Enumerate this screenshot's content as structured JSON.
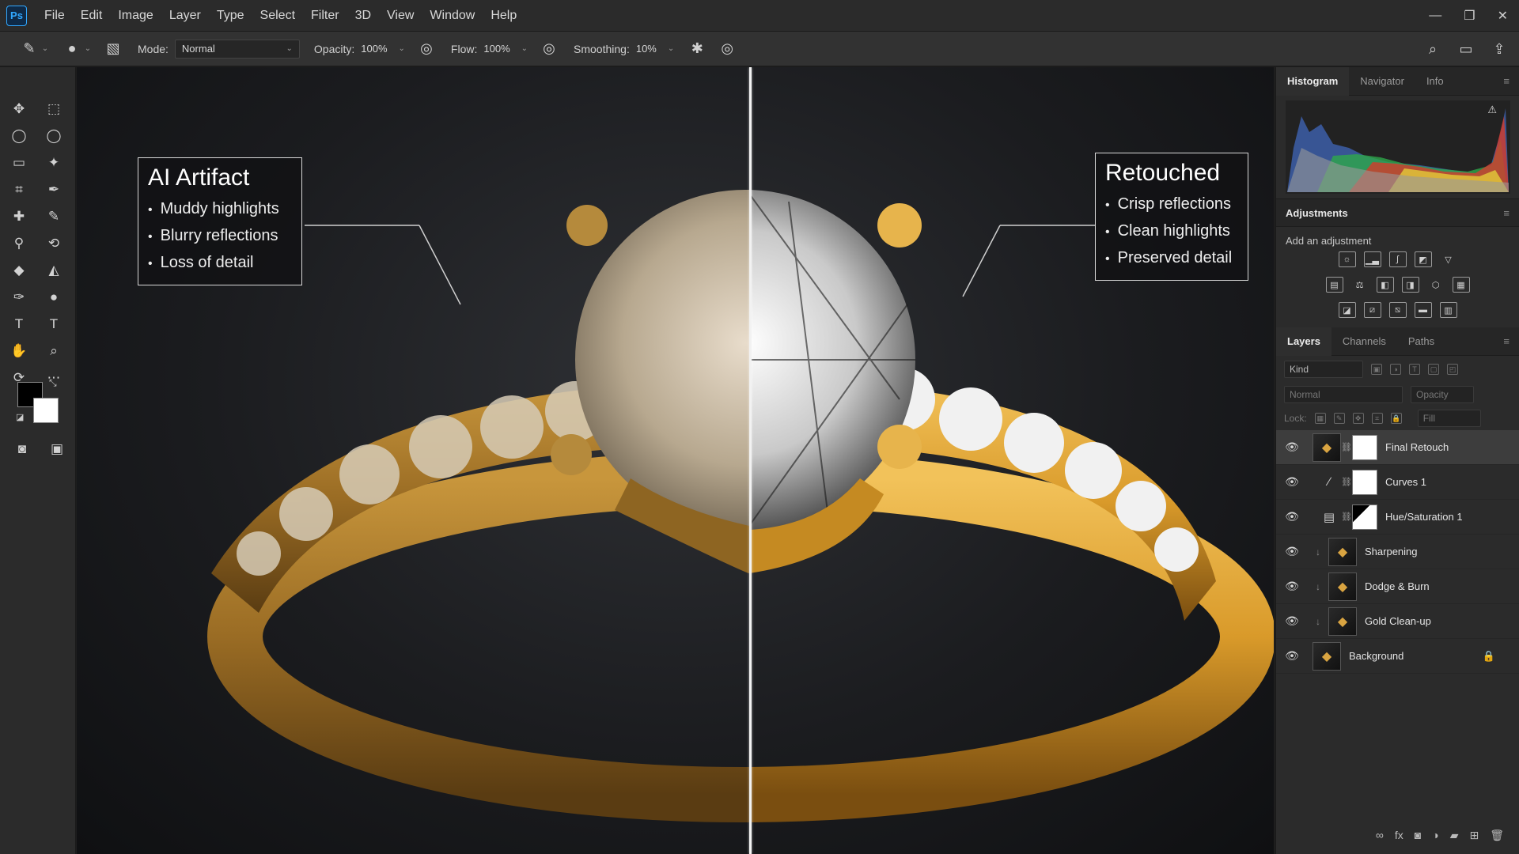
{
  "app": {
    "logo": "Ps"
  },
  "menu": [
    "File",
    "Edit",
    "Image",
    "Layer",
    "Type",
    "Select",
    "Filter",
    "3D",
    "View",
    "Window",
    "Help"
  ],
  "window_controls": {
    "minimize": "—",
    "restore": "❐",
    "close": "✕"
  },
  "options": {
    "mode_label": "Mode:",
    "mode_value": "Normal",
    "opacity_label": "Opacity:",
    "opacity_value": "100%",
    "flow_label": "Flow:",
    "flow_value": "100%",
    "smoothing_label": "Smoothing:",
    "smoothing_value": "10%"
  },
  "callouts": {
    "left": {
      "title": "AI Artifact",
      "items": [
        "Muddy highlights",
        "Blurry reflections",
        "Loss of detail"
      ]
    },
    "right": {
      "title": "Retouched",
      "items": [
        "Crisp reflections",
        "Clean highlights",
        "Preserved detail"
      ]
    }
  },
  "panels": {
    "top_tabs": [
      "Histogram",
      "Navigator",
      "Info"
    ],
    "adjustments_title": "Adjustments",
    "adjustments_subtitle": "Add an adjustment",
    "layer_tabs": [
      "Layers",
      "Channels",
      "Paths"
    ],
    "layers_filter_kind": "Kind",
    "blend_mode": "Normal",
    "opacity_text": "Opacity",
    "lock_text": "Lock:",
    "fill_text": "Fill"
  },
  "layers": [
    {
      "name": "Final Retouch",
      "kind": "pixel-mask",
      "selected": true
    },
    {
      "name": "Curves 1",
      "kind": "curves"
    },
    {
      "name": "Hue/Saturation 1",
      "kind": "huesat"
    },
    {
      "name": "Sharpening",
      "kind": "clipped"
    },
    {
      "name": "Dodge & Burn",
      "kind": "clipped"
    },
    {
      "name": "Gold Clean-up",
      "kind": "clipped"
    },
    {
      "name": "Background",
      "kind": "background",
      "locked": true
    }
  ],
  "colors": {
    "accent": "#31a8ff",
    "gold": "#d9a441",
    "panel_bg": "#2b2b2b",
    "canvas_bg": "#1b1c1f"
  }
}
